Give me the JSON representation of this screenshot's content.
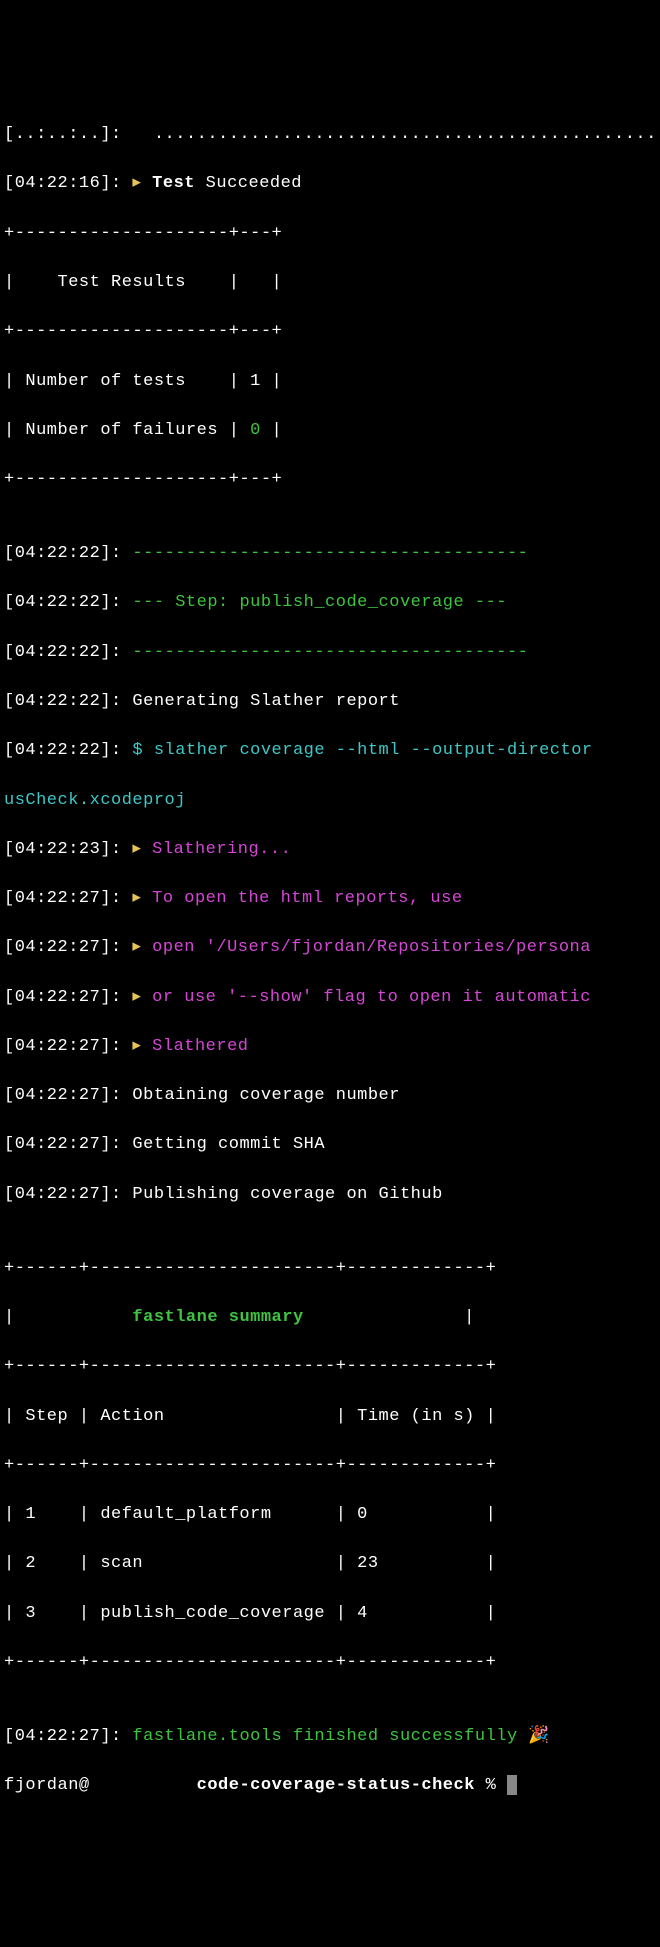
{
  "lines": {
    "topcut": "[..:..:..]:   ....................................................",
    "l1_ts": "[04:22:16]:",
    "l1_arrow": " ▸",
    "l1_test": " Test",
    "l1_succ": " Succeeded",
    "tr_border": "+--------------------+---+",
    "tr_title": "|    Test Results    |   |",
    "tr_row1": "| Number of tests    | 1 |",
    "tr_row2a": "| Number of failures | ",
    "tr_row2b": "0",
    "tr_row2c": " |",
    "blank": "",
    "l2_ts": "[04:22:22]: ",
    "l2_dash": "-------------------------------------",
    "l3_ts": "[04:22:22]: ",
    "l3_step": "--- Step: publish_code_coverage ---",
    "l4_ts": "[04:22:22]: ",
    "l4_dash": "-------------------------------------",
    "l5_ts": "[04:22:22]: ",
    "l5_txt": "Generating Slather report",
    "l6_ts": "[04:22:22]: ",
    "l6_cmd": "$ slather coverage --html --output-director",
    "l6b": "usCheck.xcodeproj",
    "l7_ts": "[04:22:23]: ",
    "l7_arrow": "▸",
    "l7_txt": " Slathering...",
    "l8_ts": "[04:22:27]: ",
    "l8_arrow": "▸",
    "l8_txt": " To open the html reports, use",
    "l9_ts": "[04:22:27]: ",
    "l9_arrow": "▸",
    "l9_txt": " open '/Users/fjordan/Repositories/persona",
    "l10_ts": "[04:22:27]: ",
    "l10_arrow": "▸",
    "l10_txt": " or use '--show' flag to open it automatic",
    "l11_ts": "[04:22:27]: ",
    "l11_arrow": "▸",
    "l11_txt": " Slathered",
    "l12_ts": "[04:22:27]: ",
    "l12_txt": "Obtaining coverage number",
    "l13_ts": "[04:22:27]: ",
    "l13_txt": "Getting commit SHA",
    "l14_ts": "[04:22:27]: ",
    "l14_txt": "Publishing coverage on Github",
    "fs_border": "+------+-----------------------+-------------+",
    "fs_title_a": "|           ",
    "fs_title_b": "fastlane summary",
    "fs_title_c": "               |",
    "fs_header": "| Step | Action                | Time (in s) |",
    "fs_row1": "| 1    | default_platform      | 0           |",
    "fs_row2": "| 2    | scan                  | 23          |",
    "fs_row3": "| 3    | publish_code_coverage | 4           |",
    "l15_ts": "[04:22:27]: ",
    "l15_txt": "fastlane.tools finished successfully",
    "l15_emoji": " 🎉",
    "prompt_user": "fjordan@",
    "prompt_space": "          ",
    "prompt_path": "code-coverage-status-check",
    "prompt_sym": " % "
  }
}
